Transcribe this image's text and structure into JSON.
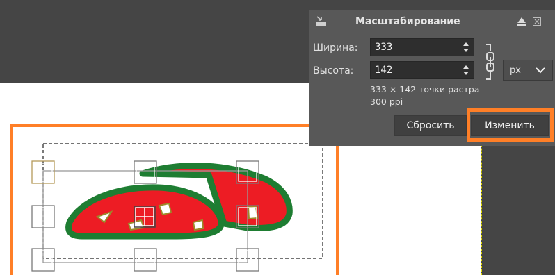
{
  "dialog": {
    "title": "Масштабирование",
    "width_label": "Ширина:",
    "width_value": "333",
    "height_label": "Высота:",
    "height_value": "142",
    "unit": "px",
    "size_info": "333 × 142 точки растра",
    "resolution_info": "300 ppi",
    "reset_label": "Сбросить",
    "apply_label": "Изменить"
  },
  "icons": {
    "title_icon": "scale-tool-icon",
    "pin": "triangle-up-icon",
    "close": "close-icon",
    "chain": "chain-link-icon",
    "unit_dropdown": "chevron-down-icon"
  },
  "colors": {
    "highlight": "#ff7f27",
    "shape_fill": "#ed1c24",
    "shape_outline": "#1e7d32",
    "dialog_bg": "#585858",
    "canvas_bg": "#ffffff",
    "workspace_bg": "#454545"
  }
}
